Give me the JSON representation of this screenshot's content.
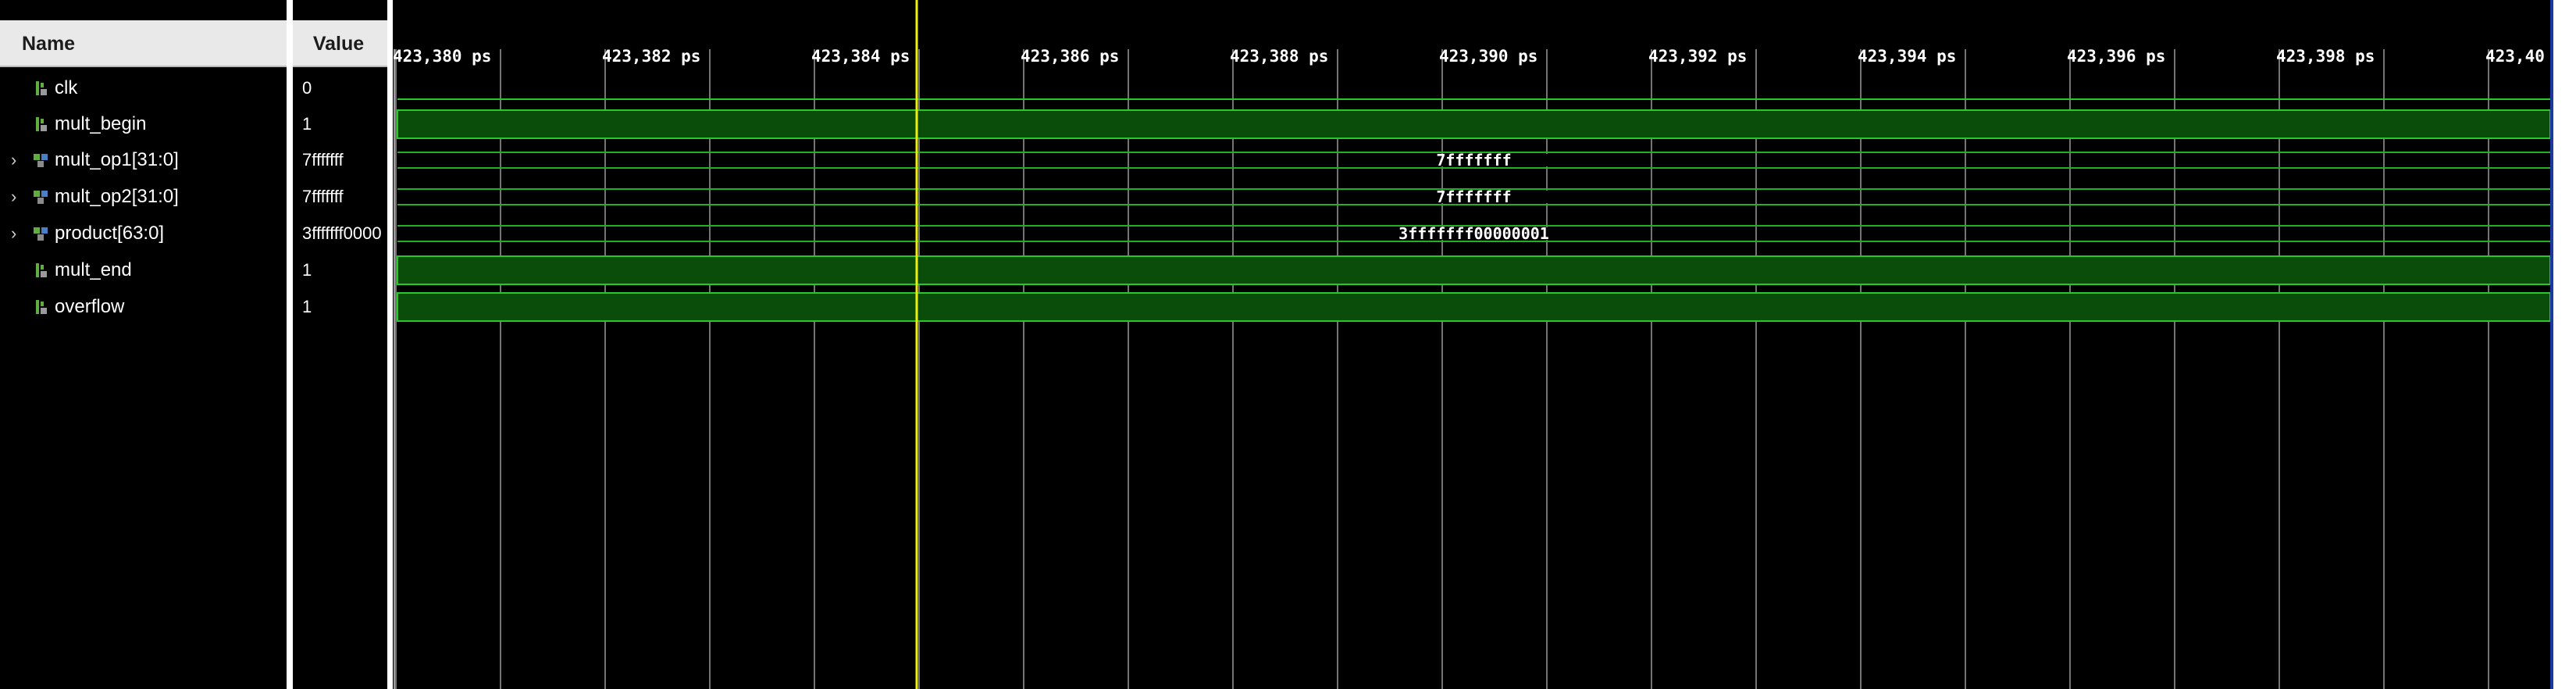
{
  "headers": {
    "name": "Name",
    "value": "Value"
  },
  "signals": [
    {
      "name": "clk",
      "value": "0",
      "type": "bit",
      "expandable": false
    },
    {
      "name": "mult_begin",
      "value": "1",
      "type": "bit",
      "expandable": false
    },
    {
      "name": "mult_op1[31:0]",
      "value": "7fffffff",
      "type": "bus",
      "expandable": true
    },
    {
      "name": "mult_op2[31:0]",
      "value": "7fffffff",
      "type": "bus",
      "expandable": true
    },
    {
      "name": "product[63:0]",
      "value": "3fffffff0000",
      "type": "bus",
      "expandable": true
    },
    {
      "name": "mult_end",
      "value": "1",
      "type": "bit",
      "expandable": false
    },
    {
      "name": "overflow",
      "value": "1",
      "type": "bit",
      "expandable": false
    }
  ],
  "waves": {
    "clk": 0,
    "mult_begin": 1,
    "mult_op1": "7fffffff",
    "mult_op2": "7fffffff",
    "product": "3fffffff00000001",
    "mult_end": 1,
    "overflow": 1
  },
  "ruler": {
    "labels": [
      "423,380 ps",
      "423,382 ps",
      "423,384 ps",
      "423,386 ps",
      "423,388 ps",
      "423,390 ps",
      "423,392 ps",
      "423,394 ps",
      "423,396 ps",
      "423,398 ps",
      "423,40"
    ]
  },
  "colors": {
    "background": "#000000",
    "signal_high_fill": "#0a4d0a",
    "signal_edge": "#28c828",
    "bus_edge": "#22b022",
    "grid": "#9a9a9a",
    "cursor": "#f0f000"
  }
}
